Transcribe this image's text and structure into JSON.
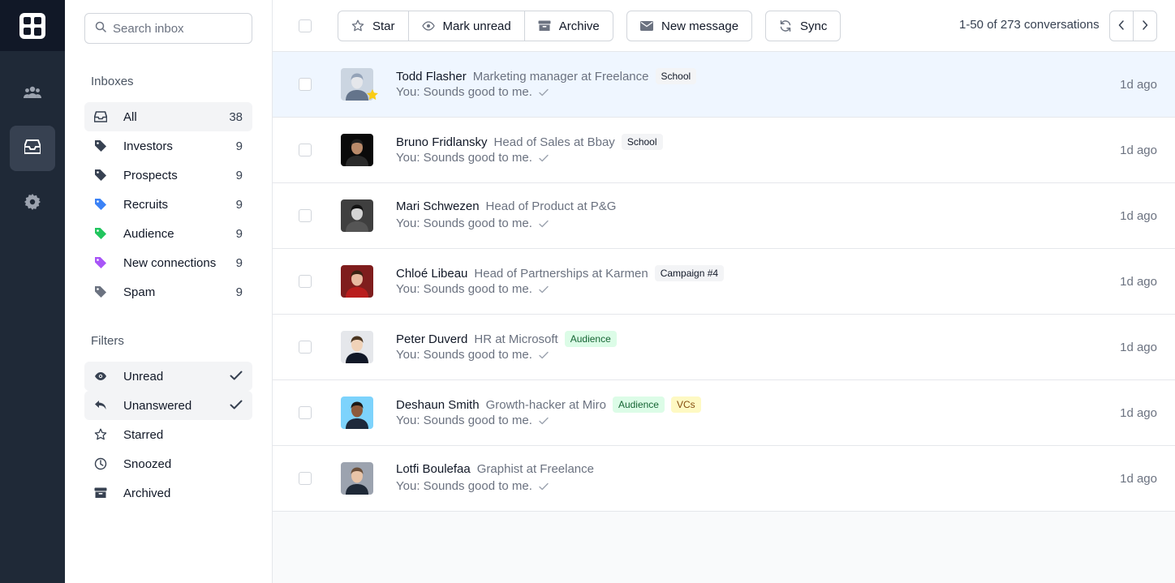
{
  "rail": {
    "items": [
      {
        "name": "users-icon"
      },
      {
        "name": "inbox-icon"
      },
      {
        "name": "gear-icon"
      }
    ]
  },
  "sidebar": {
    "search_placeholder": "Search inbox",
    "inboxes_title": "Inboxes",
    "inboxes": [
      {
        "label": "All",
        "count": "38",
        "icon": "inbox-icon",
        "color": "#374151"
      },
      {
        "label": "Investors",
        "count": "9",
        "icon": "tag-icon",
        "color": "#374151"
      },
      {
        "label": "Prospects",
        "count": "9",
        "icon": "tag-icon",
        "color": "#374151"
      },
      {
        "label": "Recruits",
        "count": "9",
        "icon": "tag-icon",
        "color": "#3b82f6"
      },
      {
        "label": "Audience",
        "count": "9",
        "icon": "tag-icon",
        "color": "#22c55e"
      },
      {
        "label": "New connections",
        "count": "9",
        "icon": "tag-icon",
        "color": "#a855f7"
      },
      {
        "label": "Spam",
        "count": "9",
        "icon": "tag-icon",
        "color": "#6b7280"
      }
    ],
    "filters_title": "Filters",
    "filters": [
      {
        "label": "Unread",
        "icon": "eye-icon",
        "checked": true
      },
      {
        "label": "Unanswered",
        "icon": "reply-icon",
        "checked": true
      },
      {
        "label": "Starred",
        "icon": "star-icon",
        "checked": false
      },
      {
        "label": "Snoozed",
        "icon": "clock-icon",
        "checked": false
      },
      {
        "label": "Archived",
        "icon": "archive-icon",
        "checked": false
      }
    ]
  },
  "toolbar": {
    "star_label": "Star",
    "mark_unread_label": "Mark unread",
    "archive_label": "Archive",
    "new_message_label": "New message",
    "sync_label": "Sync",
    "pagination": "1-50 of 273 conversations"
  },
  "conversations": [
    {
      "name": "Todd Flasher",
      "title": "Marketing manager at Freelance",
      "tags": [
        {
          "text": "School",
          "color": "gray"
        }
      ],
      "preview": "You: Sounds good to me.",
      "time": "1d ago",
      "starred": true,
      "highlight": true
    },
    {
      "name": "Bruno Fridlansky",
      "title": "Head of Sales at Bbay",
      "tags": [
        {
          "text": "School",
          "color": "gray"
        }
      ],
      "preview": "You: Sounds good to me.",
      "time": "1d ago"
    },
    {
      "name": "Mari Schwezen",
      "title": "Head of Product at P&G",
      "tags": [],
      "preview": "You: Sounds good to me.",
      "time": "1d ago"
    },
    {
      "name": "Chloé Libeau",
      "title": "Head of Partnerships at Karmen",
      "tags": [
        {
          "text": "Campaign #4",
          "color": "gray"
        }
      ],
      "preview": "You: Sounds good to me.",
      "time": "1d ago"
    },
    {
      "name": "Peter Duverd",
      "title": "HR at Microsoft",
      "tags": [
        {
          "text": "Audience",
          "color": "green"
        }
      ],
      "preview": "You: Sounds good to me.",
      "time": "1d ago"
    },
    {
      "name": "Deshaun Smith",
      "title": "Growth-hacker at Miro",
      "tags": [
        {
          "text": "Audience",
          "color": "green"
        },
        {
          "text": "VCs",
          "color": "yellow"
        }
      ],
      "preview": "You: Sounds good to me.",
      "time": "1d ago"
    },
    {
      "name": "Lotfi Boulefaa",
      "title": "Graphist at Freelance",
      "tags": [],
      "preview": "You: Sounds good to me.",
      "time": "1d ago"
    }
  ]
}
